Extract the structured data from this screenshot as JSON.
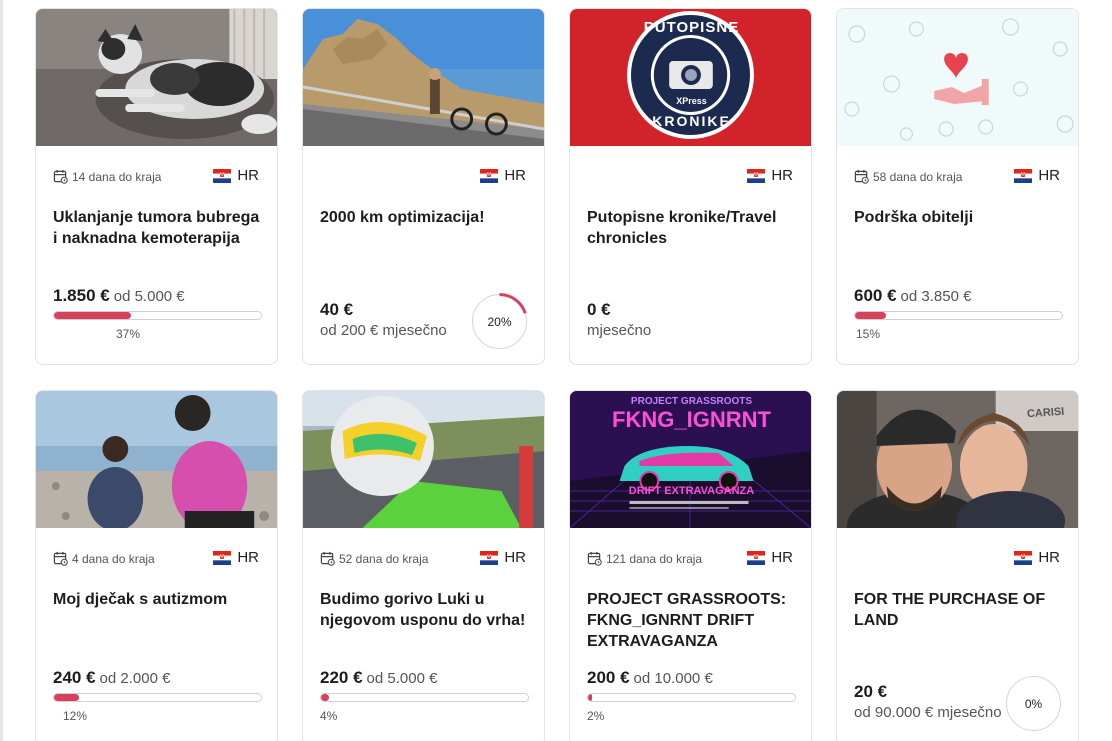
{
  "campaigns": [
    {
      "deadline": "14 dana do kraja",
      "country": "HR",
      "title": "Uklanjanje tumora bubrega i naknadna kemoterapija",
      "raised": "1.850 €",
      "goal": "od 5.000 €",
      "percent": "37%",
      "progress": 0.37
    },
    {
      "deadline": "",
      "country": "HR",
      "title": "2000 km optimizacija!",
      "raised": "40 €",
      "sub": "od 200 € mjesečno",
      "percent": "20%",
      "progress": 0.2
    },
    {
      "deadline": "",
      "country": "HR",
      "title": "Putopisne kronike/Travel chronicles",
      "raised": "0 €",
      "sub": "mjesečno",
      "logo_top": "PUTOPISNE",
      "logo_bottom": "KRONIKE",
      "logo_brand": "XPress"
    },
    {
      "deadline": "58 dana do kraja",
      "country": "HR",
      "title": "Podrška obitelji",
      "raised": "600 €",
      "goal": "od 3.850 €",
      "percent": "15%",
      "progress": 0.15
    },
    {
      "deadline": "4 dana do kraja",
      "country": "HR",
      "title": "Moj dječak s autizmom",
      "raised": "240 €",
      "goal": "od 2.000 €",
      "percent": "12%",
      "progress": 0.12
    },
    {
      "deadline": "52 dana do kraja",
      "country": "HR",
      "title": "Budimo gorivo Luki u njegovom usponu do vrha!",
      "raised": "220 €",
      "goal": "od 5.000 €",
      "percent": "4%",
      "progress": 0.04
    },
    {
      "deadline": "121 dana do kraja",
      "country": "HR",
      "title": "PROJECT GRASSROOTS: FKNG_IGNRNT DRIFT EXTRAVAGANZA",
      "raised": "200 €",
      "goal": "od 10.000 €",
      "percent": "2%",
      "progress": 0.02,
      "poster_top": "PROJECT GRASSROOTS",
      "poster_main": "FKNG_IGNRNT",
      "poster_bottom": "DRIFT EXTRAVAGANZA"
    },
    {
      "deadline": "",
      "country": "HR",
      "title": "FOR THE PURCHASE OF LAND",
      "raised": "20 €",
      "sub": "od 90.000 € mjesečno",
      "percent": "0%",
      "progress": 0.0,
      "sign_text": "CARISI"
    }
  ],
  "colors": {
    "accent": "#d8405b",
    "text": "#1d1d1f",
    "muted": "#555555",
    "border": "#e3e3e3",
    "logo_red": "#d2232a",
    "logo_navy": "#1b2a4e"
  },
  "icons": {
    "deadline": "calendar-clock-icon",
    "flag": "croatia-flag-icon",
    "donation": "heart-hand-icon"
  }
}
